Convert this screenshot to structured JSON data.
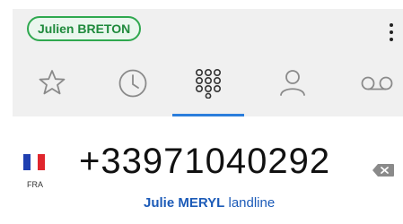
{
  "header": {
    "user_name": "Julien BRETON"
  },
  "tabs": [
    {
      "icon": "star-icon"
    },
    {
      "icon": "clock-icon"
    },
    {
      "icon": "dialpad-icon",
      "active": true
    },
    {
      "icon": "person-icon"
    },
    {
      "icon": "voicemail-icon"
    }
  ],
  "dialer": {
    "country_code": "FRA",
    "number": "+33971040292",
    "caller_first": "Julie",
    "caller_last": "MERYL",
    "line_type": "landline"
  },
  "colors": {
    "accent": "#2a7ddc",
    "pill_green": "#2fa84f",
    "caller_blue": "#1c5bb8"
  }
}
